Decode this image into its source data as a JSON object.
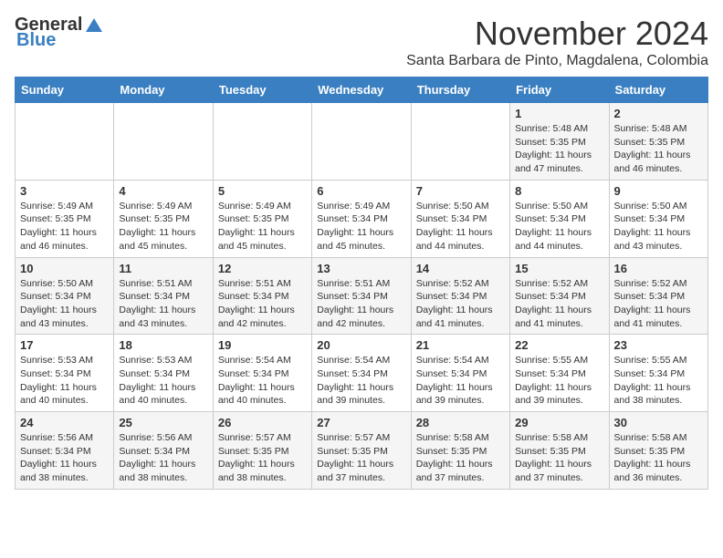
{
  "header": {
    "logo_general": "General",
    "logo_blue": "Blue",
    "month": "November 2024",
    "location": "Santa Barbara de Pinto, Magdalena, Colombia"
  },
  "days_of_week": [
    "Sunday",
    "Monday",
    "Tuesday",
    "Wednesday",
    "Thursday",
    "Friday",
    "Saturday"
  ],
  "weeks": [
    [
      {
        "day": "",
        "info": ""
      },
      {
        "day": "",
        "info": ""
      },
      {
        "day": "",
        "info": ""
      },
      {
        "day": "",
        "info": ""
      },
      {
        "day": "",
        "info": ""
      },
      {
        "day": "1",
        "info": "Sunrise: 5:48 AM\nSunset: 5:35 PM\nDaylight: 11 hours and 47 minutes."
      },
      {
        "day": "2",
        "info": "Sunrise: 5:48 AM\nSunset: 5:35 PM\nDaylight: 11 hours and 46 minutes."
      }
    ],
    [
      {
        "day": "3",
        "info": "Sunrise: 5:49 AM\nSunset: 5:35 PM\nDaylight: 11 hours and 46 minutes."
      },
      {
        "day": "4",
        "info": "Sunrise: 5:49 AM\nSunset: 5:35 PM\nDaylight: 11 hours and 45 minutes."
      },
      {
        "day": "5",
        "info": "Sunrise: 5:49 AM\nSunset: 5:35 PM\nDaylight: 11 hours and 45 minutes."
      },
      {
        "day": "6",
        "info": "Sunrise: 5:49 AM\nSunset: 5:34 PM\nDaylight: 11 hours and 45 minutes."
      },
      {
        "day": "7",
        "info": "Sunrise: 5:50 AM\nSunset: 5:34 PM\nDaylight: 11 hours and 44 minutes."
      },
      {
        "day": "8",
        "info": "Sunrise: 5:50 AM\nSunset: 5:34 PM\nDaylight: 11 hours and 44 minutes."
      },
      {
        "day": "9",
        "info": "Sunrise: 5:50 AM\nSunset: 5:34 PM\nDaylight: 11 hours and 43 minutes."
      }
    ],
    [
      {
        "day": "10",
        "info": "Sunrise: 5:50 AM\nSunset: 5:34 PM\nDaylight: 11 hours and 43 minutes."
      },
      {
        "day": "11",
        "info": "Sunrise: 5:51 AM\nSunset: 5:34 PM\nDaylight: 11 hours and 43 minutes."
      },
      {
        "day": "12",
        "info": "Sunrise: 5:51 AM\nSunset: 5:34 PM\nDaylight: 11 hours and 42 minutes."
      },
      {
        "day": "13",
        "info": "Sunrise: 5:51 AM\nSunset: 5:34 PM\nDaylight: 11 hours and 42 minutes."
      },
      {
        "day": "14",
        "info": "Sunrise: 5:52 AM\nSunset: 5:34 PM\nDaylight: 11 hours and 41 minutes."
      },
      {
        "day": "15",
        "info": "Sunrise: 5:52 AM\nSunset: 5:34 PM\nDaylight: 11 hours and 41 minutes."
      },
      {
        "day": "16",
        "info": "Sunrise: 5:52 AM\nSunset: 5:34 PM\nDaylight: 11 hours and 41 minutes."
      }
    ],
    [
      {
        "day": "17",
        "info": "Sunrise: 5:53 AM\nSunset: 5:34 PM\nDaylight: 11 hours and 40 minutes."
      },
      {
        "day": "18",
        "info": "Sunrise: 5:53 AM\nSunset: 5:34 PM\nDaylight: 11 hours and 40 minutes."
      },
      {
        "day": "19",
        "info": "Sunrise: 5:54 AM\nSunset: 5:34 PM\nDaylight: 11 hours and 40 minutes."
      },
      {
        "day": "20",
        "info": "Sunrise: 5:54 AM\nSunset: 5:34 PM\nDaylight: 11 hours and 39 minutes."
      },
      {
        "day": "21",
        "info": "Sunrise: 5:54 AM\nSunset: 5:34 PM\nDaylight: 11 hours and 39 minutes."
      },
      {
        "day": "22",
        "info": "Sunrise: 5:55 AM\nSunset: 5:34 PM\nDaylight: 11 hours and 39 minutes."
      },
      {
        "day": "23",
        "info": "Sunrise: 5:55 AM\nSunset: 5:34 PM\nDaylight: 11 hours and 38 minutes."
      }
    ],
    [
      {
        "day": "24",
        "info": "Sunrise: 5:56 AM\nSunset: 5:34 PM\nDaylight: 11 hours and 38 minutes."
      },
      {
        "day": "25",
        "info": "Sunrise: 5:56 AM\nSunset: 5:34 PM\nDaylight: 11 hours and 38 minutes."
      },
      {
        "day": "26",
        "info": "Sunrise: 5:57 AM\nSunset: 5:35 PM\nDaylight: 11 hours and 38 minutes."
      },
      {
        "day": "27",
        "info": "Sunrise: 5:57 AM\nSunset: 5:35 PM\nDaylight: 11 hours and 37 minutes."
      },
      {
        "day": "28",
        "info": "Sunrise: 5:58 AM\nSunset: 5:35 PM\nDaylight: 11 hours and 37 minutes."
      },
      {
        "day": "29",
        "info": "Sunrise: 5:58 AM\nSunset: 5:35 PM\nDaylight: 11 hours and 37 minutes."
      },
      {
        "day": "30",
        "info": "Sunrise: 5:58 AM\nSunset: 5:35 PM\nDaylight: 11 hours and 36 minutes."
      }
    ]
  ]
}
